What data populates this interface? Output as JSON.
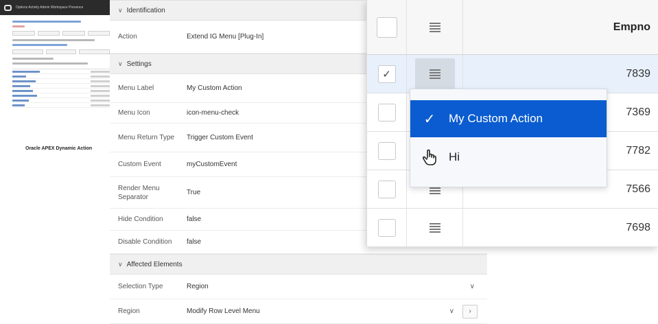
{
  "thumbnail": {
    "nav_text": "Options  Activity  Admin  Workspace  Presence",
    "caption": "Oracle APEX Dynamic Action"
  },
  "properties": {
    "sections": {
      "identification": "Identification",
      "settings": "Settings",
      "affected_elements": "Affected Elements"
    },
    "action": {
      "label": "Action",
      "value": "Extend IG Menu [Plug-In]"
    },
    "menu_label": {
      "label": "Menu Label",
      "value": "My Custom Action"
    },
    "menu_icon": {
      "label": "Menu Icon",
      "value": "icon-menu-check"
    },
    "menu_return_type": {
      "label": "Menu Return Type",
      "value": "Trigger Custom Event"
    },
    "custom_event": {
      "label": "Custom Event",
      "value": "myCustomEvent"
    },
    "render_menu_separator": {
      "label": "Render Menu Separator",
      "value": "True"
    },
    "hide_condition": {
      "label": "Hide Condition",
      "value": "false"
    },
    "disable_condition": {
      "label": "Disable Condition",
      "value": "false"
    },
    "selection_type": {
      "label": "Selection Type",
      "value": "Region"
    },
    "region": {
      "label": "Region",
      "value": "Modify Row Level Menu"
    }
  },
  "grid": {
    "column_header": "Empno",
    "rows": [
      {
        "empno": "7839",
        "checked": true
      },
      {
        "empno": "7369",
        "checked": false
      },
      {
        "empno": "7782",
        "checked": false
      },
      {
        "empno": "7566",
        "checked": false
      },
      {
        "empno": "7698",
        "checked": false
      }
    ],
    "check_glyph": "✓"
  },
  "context_menu": {
    "items": [
      {
        "label": "My Custom Action",
        "icon": "check-icon",
        "glyph": "✓"
      },
      {
        "label": "Hi",
        "icon": "hand-pointer-icon"
      }
    ]
  },
  "icons": {
    "collapse": "∨",
    "select_chevron": "∨",
    "nav_arrow": "›"
  },
  "colors": {
    "menu_active": "#0a5cd0",
    "selected_row": "#e8f1fb"
  }
}
